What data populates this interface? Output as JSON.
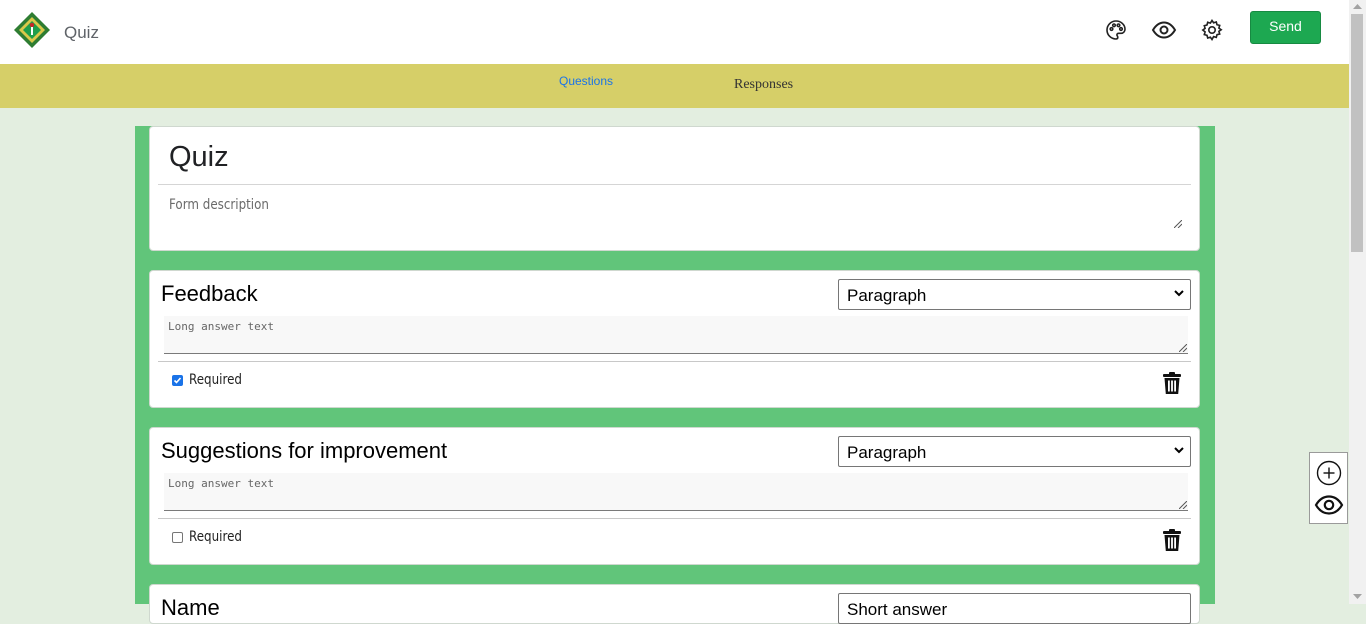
{
  "header": {
    "app_title": "Quiz",
    "send_label": "Send",
    "icons": [
      "palette-icon",
      "eye-icon",
      "gear-icon"
    ]
  },
  "tabs": {
    "questions": "Questions",
    "responses": "Responses"
  },
  "form": {
    "title": "Quiz",
    "description_placeholder": "Form description"
  },
  "questions": [
    {
      "title": "Feedback",
      "type": "Paragraph",
      "answer_placeholder": "Long answer text",
      "required_label": "Required",
      "required": true
    },
    {
      "title": "Suggestions for improvement",
      "type": "Paragraph",
      "answer_placeholder": "Long answer text",
      "required_label": "Required",
      "required": false
    },
    {
      "title": "Name",
      "type": "Short answer"
    }
  ],
  "colors": {
    "accent": "#1da851",
    "tab_bar": "#d6cf68",
    "panel": "#61c57a",
    "background": "#e3eee0",
    "link": "#1a73e8"
  }
}
